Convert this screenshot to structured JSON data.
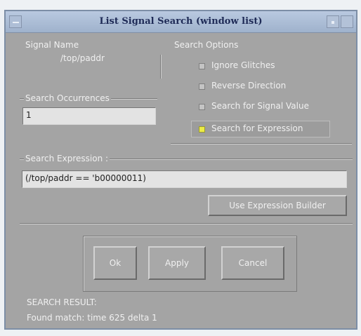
{
  "window": {
    "title": "List Signal Search (window list)"
  },
  "signal_name": {
    "label": "Signal Name",
    "value": "/top/paddr"
  },
  "search_options": {
    "label": "Search Options",
    "items": [
      {
        "label": "Ignore Glitches",
        "checked": false
      },
      {
        "label": "Reverse Direction",
        "checked": false
      },
      {
        "label": "Search for Signal Value",
        "checked": false
      },
      {
        "label": "Search for Expression",
        "checked": true
      }
    ]
  },
  "search_occurrences": {
    "label": "Search Occurrences",
    "value": "1"
  },
  "search_expression": {
    "label": "Search Expression :",
    "value": "(/top/paddr == 'b00000011)",
    "builder_button": "Use Expression Builder"
  },
  "buttons": {
    "ok": "Ok",
    "apply": "Apply",
    "cancel": "Cancel"
  },
  "result": {
    "heading": "SEARCH RESULT:",
    "text": "Found match: time 625 delta 1"
  },
  "colors": {
    "selected_check": "#ecec45",
    "title_text": "#1e2a56"
  }
}
